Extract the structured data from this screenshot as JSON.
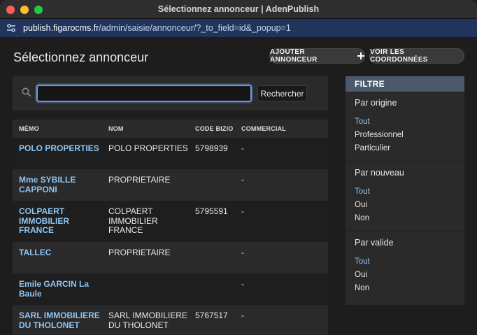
{
  "window": {
    "title": "Sélectionnez annonceur | AdenPublish"
  },
  "urlbar": {
    "host": "publish.figarocms.fr",
    "path": "/admin/saisie/annonceur/?_to_field=id&_popup=1"
  },
  "page": {
    "title": "Sélectionnez annonceur"
  },
  "actions": {
    "add_label": "AJOUTER ANNONCEUR",
    "add_icon": "plus-icon",
    "coords_label": "VOIR LES COORDONNÉES"
  },
  "search": {
    "value": "",
    "placeholder": "",
    "button_label": "Rechercher"
  },
  "table": {
    "headers": {
      "memo": "MÉMO",
      "nom": "NOM",
      "code": "CODE BIZIO",
      "comm": "COMMERCIAL"
    },
    "rows": [
      {
        "memo": "POLO PROPERTIES",
        "nom": "POLO PROPERTIES",
        "code": "5798939",
        "comm": "-"
      },
      {
        "memo": "Mme SYBILLE CAPPONI",
        "nom": "PROPRIETAIRE",
        "code": "",
        "comm": "-"
      },
      {
        "memo": "COLPAERT IMMOBILIER FRANCE",
        "nom": "COLPAERT IMMOBILIER FRANCE",
        "code": "5795591",
        "comm": "-"
      },
      {
        "memo": "TALLEC",
        "nom": "PROPRIETAIRE",
        "code": "",
        "comm": "-"
      },
      {
        "memo": "Emile GARCIN La Baule",
        "nom": "",
        "code": "",
        "comm": "-"
      },
      {
        "memo": "SARL IMMOBILIERE DU THOLONET",
        "nom": "SARL IMMOBILIERE DU THOLONET",
        "code": "5767517",
        "comm": "-"
      }
    ]
  },
  "filter": {
    "title": "FILTRE",
    "groups": [
      {
        "title": "Par origine",
        "options": [
          "Tout",
          "Professionnel",
          "Particulier"
        ],
        "active": "Tout"
      },
      {
        "title": "Par nouveau",
        "options": [
          "Tout",
          "Oui",
          "Non"
        ],
        "active": "Tout"
      },
      {
        "title": "Par valide",
        "options": [
          "Tout",
          "Oui",
          "Non"
        ],
        "active": "Tout"
      }
    ]
  },
  "colors": {
    "link": "#8ec4f2",
    "url_bar": "#20345c",
    "filter_header": "#4a5a6a",
    "focus_ring": "#6f9bd8"
  }
}
